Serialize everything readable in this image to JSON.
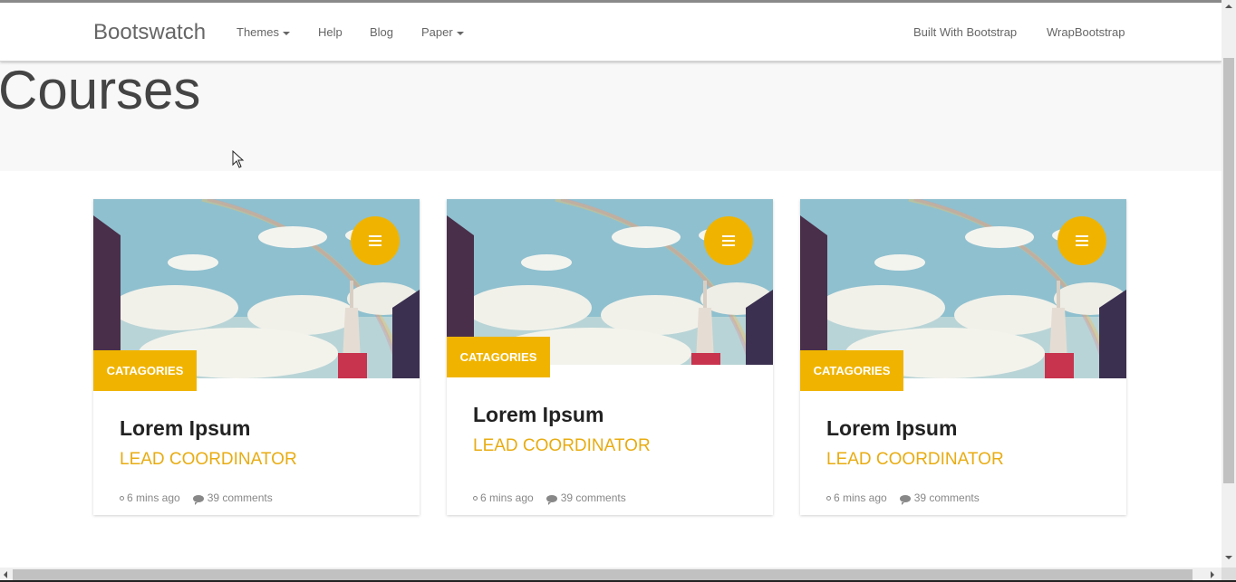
{
  "navbar": {
    "brand": "Bootswatch",
    "items": [
      {
        "label": "Themes",
        "dropdown": true
      },
      {
        "label": "Help",
        "dropdown": false
      },
      {
        "label": "Blog",
        "dropdown": false
      },
      {
        "label": "Paper",
        "dropdown": true
      }
    ],
    "right_items": [
      {
        "label": "Built With Bootstrap"
      },
      {
        "label": "WrapBootstrap"
      }
    ]
  },
  "header": {
    "title": "Courses"
  },
  "cards": [
    {
      "badge": "CATAGORIES",
      "title": "Lorem Ipsum",
      "subtitle": "LEAD COORDINATOR",
      "time": "6 mins ago",
      "comments": "39 comments",
      "menu_icon": "bars-icon"
    },
    {
      "badge": "CATAGORIES",
      "title": "Lorem Ipsum",
      "subtitle": "LEAD COORDINATOR",
      "time": "6 mins ago",
      "comments": "39 comments",
      "menu_icon": "bars-icon"
    },
    {
      "badge": "CATAGORIES",
      "title": "Lorem Ipsum",
      "subtitle": "LEAD COORDINATOR",
      "time": "6 mins ago",
      "comments": "39 comments",
      "menu_icon": "bars-icon"
    }
  ],
  "colors": {
    "accent": "#f0b400",
    "subtitle": "#e8ac12",
    "header_band": "#f8f8f8"
  }
}
